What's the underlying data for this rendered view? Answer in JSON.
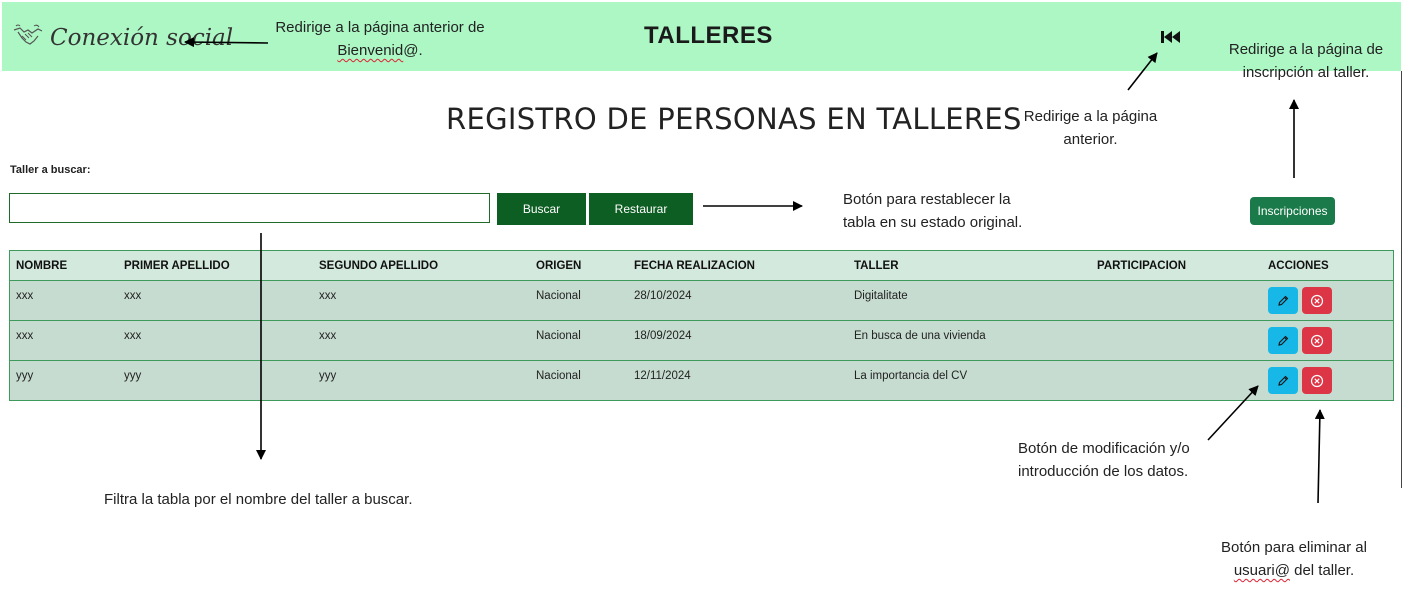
{
  "header": {
    "logo_text": "Conexión social",
    "title": "TALLERES",
    "back_icon": "skip-back-icon"
  },
  "page": {
    "title": "REGISTRO DE PERSONAS EN TALLERES"
  },
  "search": {
    "label": "Taller a buscar:",
    "value": "",
    "placeholder": "",
    "buscar_label": "Buscar",
    "restaurar_label": "Restaurar"
  },
  "inscripciones_label": "Inscripciones",
  "table": {
    "headers": [
      "NOMBRE",
      "PRIMER APELLIDO",
      "SEGUNDO APELLIDO",
      "ORIGEN",
      "FECHA REALIZACION",
      "TALLER",
      "PARTICIPACION",
      "ACCIONES"
    ],
    "rows": [
      [
        "xxx",
        "xxx",
        "xxx",
        "Nacional",
        "28/10/2024",
        "Digitalitate",
        ""
      ],
      [
        "xxx",
        "xxx",
        "xxx",
        "Nacional",
        "18/09/2024",
        "En busca de una vivienda",
        ""
      ],
      [
        "yyy",
        "yyy",
        "yyy",
        "Nacional",
        "12/11/2024",
        "La importancia del CV",
        ""
      ]
    ],
    "edit_icon": "pencil-icon",
    "delete_icon": "circle-x-icon"
  },
  "colors": {
    "header_bg": "#acf7c4",
    "button_green": "#0d5e22",
    "inscripciones_green": "#1a7a4a",
    "edit_blue": "#17b8e8",
    "delete_red": "#dc3545",
    "table_bg": "#c7dcd0"
  },
  "annotations": {
    "logo_line1": "Redirige a la página anterior de",
    "logo_line2a": "Bienvenid",
    "logo_line2b": "@.",
    "back_line1": "Redirige a la página",
    "back_line2": "anterior.",
    "insc_line1": "Redirige a la página de",
    "insc_line2": "inscripción al taller.",
    "restore_line1": "Botón para restablecer la",
    "restore_line2": "tabla en su estado original.",
    "filter": "Filtra la tabla por el nombre del taller a buscar.",
    "edit_line1": "Botón de modificación y/o",
    "edit_line2": "introducción de los datos.",
    "delete_line1": "Botón para eliminar al",
    "delete_line2a": "usuari@",
    "delete_line2b": " del taller."
  }
}
